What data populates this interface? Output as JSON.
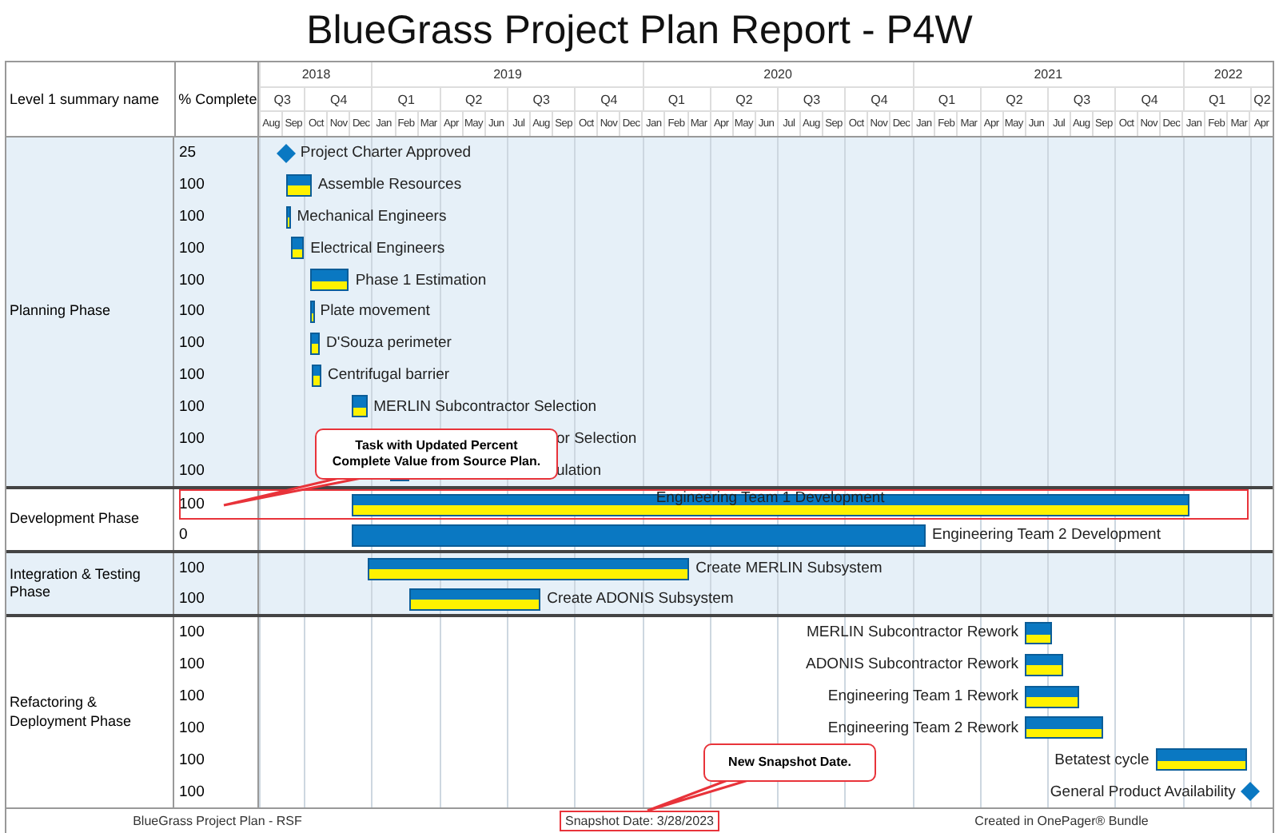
{
  "title": "BlueGrass Project Plan Report - P4W",
  "header": {
    "name_column": "Level 1 summary name",
    "complete_column": "% Complete"
  },
  "timeline": {
    "years": [
      {
        "label": "2018",
        "quarters": [
          {
            "label": "Q3",
            "months": [
              "Aug",
              "Sep"
            ]
          },
          {
            "label": "Q4",
            "months": [
              "Oct",
              "Nov",
              "Dec"
            ]
          }
        ]
      },
      {
        "label": "2019",
        "quarters": [
          {
            "label": "Q1",
            "months": [
              "Jan",
              "Feb",
              "Mar"
            ]
          },
          {
            "label": "Q2",
            "months": [
              "Apr",
              "May",
              "Jun"
            ]
          },
          {
            "label": "Q3",
            "months": [
              "Jul",
              "Aug",
              "Sep"
            ]
          },
          {
            "label": "Q4",
            "months": [
              "Oct",
              "Nov",
              "Dec"
            ]
          }
        ]
      },
      {
        "label": "2020",
        "quarters": [
          {
            "label": "Q1",
            "months": [
              "Jan",
              "Feb",
              "Mar"
            ]
          },
          {
            "label": "Q2",
            "months": [
              "Apr",
              "May",
              "Jun"
            ]
          },
          {
            "label": "Q3",
            "months": [
              "Jul",
              "Aug",
              "Sep"
            ]
          },
          {
            "label": "Q4",
            "months": [
              "Oct",
              "Nov",
              "Dec"
            ]
          }
        ]
      },
      {
        "label": "2021",
        "quarters": [
          {
            "label": "Q1",
            "months": [
              "Jan",
              "Feb",
              "Mar"
            ]
          },
          {
            "label": "Q2",
            "months": [
              "Apr",
              "May",
              "Jun"
            ]
          },
          {
            "label": "Q3",
            "months": [
              "Jul",
              "Aug",
              "Sep"
            ]
          },
          {
            "label": "Q4",
            "months": [
              "Oct",
              "Nov",
              "Dec"
            ]
          }
        ]
      },
      {
        "label": "2022",
        "quarters": [
          {
            "label": "Q1",
            "months": [
              "Jan",
              "Feb",
              "Mar"
            ]
          },
          {
            "label": "Q2",
            "months": [
              "Apr"
            ]
          }
        ]
      }
    ]
  },
  "groups": [
    {
      "name": "Planning Phase",
      "shaded": true,
      "tasks": [
        {
          "complete": "25",
          "kind": "milestone",
          "name": "Project Charter Approved",
          "highlighted": false
        },
        {
          "complete": "100",
          "kind": "bar",
          "name": "Assemble Resources",
          "highlighted": false
        },
        {
          "complete": "100",
          "kind": "bar",
          "name": "Mechanical Engineers",
          "highlighted": false
        },
        {
          "complete": "100",
          "kind": "bar",
          "name": "Electrical Engineers",
          "highlighted": false
        },
        {
          "complete": "100",
          "kind": "bar",
          "name": "Phase 1 Estimation",
          "highlighted": false
        },
        {
          "complete": "100",
          "kind": "bar",
          "name": "Plate movement",
          "highlighted": false
        },
        {
          "complete": "100",
          "kind": "bar",
          "name": "D'Souza perimeter",
          "highlighted": false
        },
        {
          "complete": "100",
          "kind": "bar",
          "name": "Centrifugal barrier",
          "highlighted": false
        },
        {
          "complete": "100",
          "kind": "bar",
          "name": "MERLIN Subcontractor Selection",
          "highlighted": false
        },
        {
          "complete": "100",
          "kind": "label",
          "name": "or Selection",
          "highlighted": false
        },
        {
          "complete": "100",
          "kind": "coveredbar",
          "name": "ulation",
          "highlighted": false
        }
      ]
    },
    {
      "name": "Development Phase",
      "shaded": false,
      "tasks": [
        {
          "complete": "100",
          "kind": "innerbar",
          "name": "Engineering Team 1 Development",
          "highlighted": true
        },
        {
          "complete": "0",
          "kind": "bar",
          "name": "Engineering Team 2 Development",
          "highlighted": false
        }
      ]
    },
    {
      "name": "Integration & Testing Phase",
      "shaded": true,
      "tasks": [
        {
          "complete": "100",
          "kind": "bar",
          "name": "Create MERLIN Subsystem",
          "highlighted": false
        },
        {
          "complete": "100",
          "kind": "bar",
          "name": "Create ADONIS Subsystem",
          "highlighted": false
        }
      ]
    },
    {
      "name": "Refactoring & Deployment Phase",
      "shaded": false,
      "tasks": [
        {
          "complete": "100",
          "kind": "leftbar",
          "name": "MERLIN Subcontractor Rework",
          "highlighted": false
        },
        {
          "complete": "100",
          "kind": "leftbar",
          "name": "ADONIS Subcontractor Rework",
          "highlighted": false
        },
        {
          "complete": "100",
          "kind": "leftbar",
          "name": "Engineering Team 1 Rework",
          "highlighted": false
        },
        {
          "complete": "100",
          "kind": "leftbar",
          "name": "Engineering Team 2 Rework",
          "highlighted": false
        },
        {
          "complete": "100",
          "kind": "leftbar",
          "name": "Betatest cycle",
          "highlighted": false
        },
        {
          "complete": "100",
          "kind": "leftmilestone",
          "name": "General Product Availability",
          "highlighted": false
        }
      ]
    }
  ],
  "footer": [
    {
      "text": "BlueGrass Project Plan - RSF",
      "highlighted": false
    },
    {
      "text": "Snapshot Date: 3/28/2023",
      "highlighted": true
    },
    {
      "text": "Created in OnePager® Bundle",
      "highlighted": false
    }
  ],
  "callouts": [
    {
      "text": "Task with Updated Percent Complete Value from Source Plan."
    },
    {
      "text": "New Snapshot Date."
    }
  ]
}
